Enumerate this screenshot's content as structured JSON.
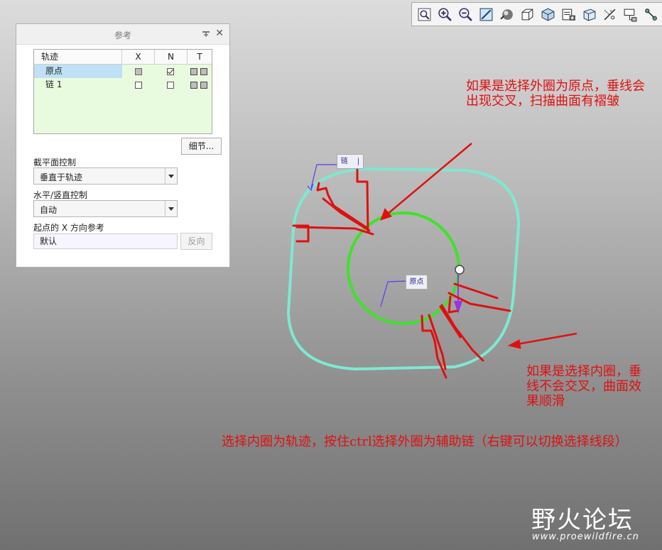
{
  "toolbar": {
    "icons": [
      "zoom-fit-icon",
      "zoom-in-icon",
      "zoom-out-icon",
      "repaint-icon",
      "shading-icon",
      "view-orientation-icon",
      "saved-views-icon",
      "view-manager-icon",
      "layers-icon",
      "datum-display-icon",
      "datum-filter-icon",
      "spin-center-icon"
    ]
  },
  "panel": {
    "title": "参考",
    "table": {
      "headers": [
        "轨迹",
        "X",
        "N",
        "T"
      ],
      "rows": [
        {
          "name": "原点",
          "x": "gray",
          "n": "checked"
        },
        {
          "name": "链 1",
          "x": "empty",
          "n": "empty"
        }
      ]
    },
    "details_button": "细节...",
    "section_control_label": "截平面控制",
    "section_control_value": "垂直于轨迹",
    "hv_control_label": "水平/竖直控制",
    "hv_control_value": "自动",
    "x_ref_label": "起点的 X 方向参考",
    "x_ref_value": "默认",
    "flip_button": "反向"
  },
  "canvas": {
    "tag_chain": "链",
    "tag_chain_mark": "|",
    "tag_origin": "原点",
    "colors": {
      "outer": "#7fe8d2",
      "inner": "#3ee22a",
      "annotation": "#e01010",
      "arrow": "#9a32e8"
    }
  },
  "annotations": {
    "top_right": "如果是选择外圈为原点，垂线会出现交叉，扫描曲面有褶皱",
    "middle_right": "如果是选择内圈，垂线不会交叉，曲面效果顺滑",
    "bottom": "选择内圈为轨迹，按住ctrl选择外圈为辅助链（右键可以切换选择线段）"
  },
  "watermark": {
    "logo": "野火论坛",
    "site": "www.proewildfire.cn"
  }
}
